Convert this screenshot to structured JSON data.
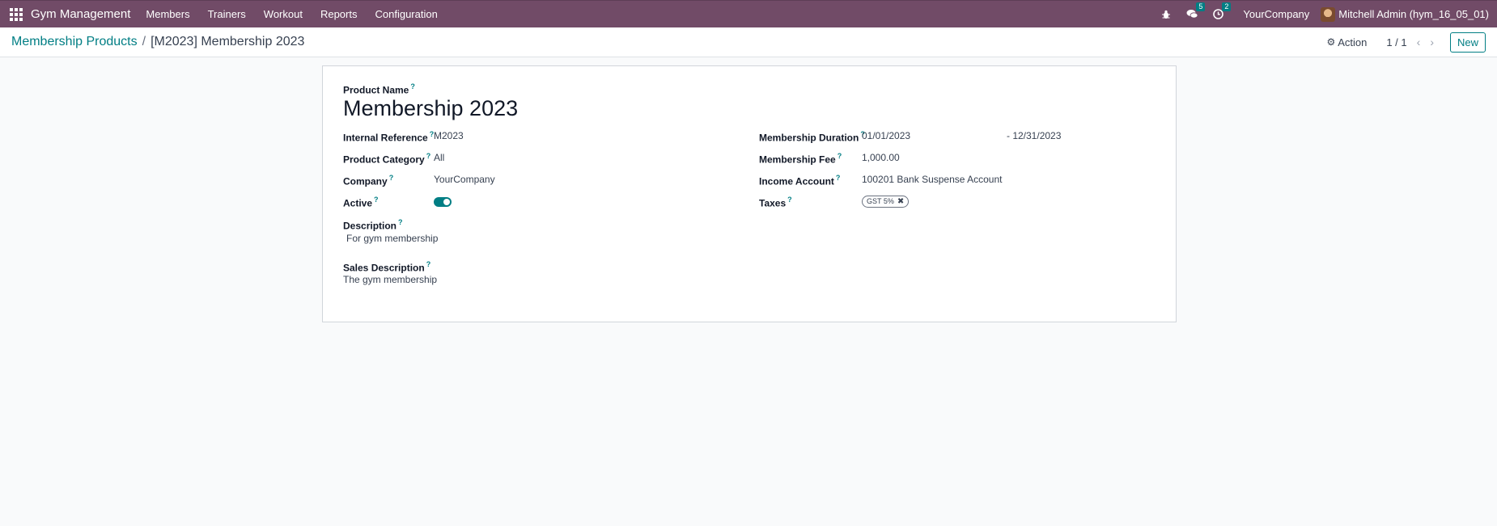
{
  "navbar": {
    "brand": "Gym Management",
    "menu": [
      "Members",
      "Trainers",
      "Workout",
      "Reports",
      "Configuration"
    ],
    "messages_count": "5",
    "activities_count": "2",
    "company": "YourCompany",
    "user": "Mitchell Admin (hym_16_05_01)"
  },
  "control": {
    "breadcrumb_parent": "Membership Products",
    "breadcrumb_sep": "/",
    "breadcrumb_current": "[M2023] Membership 2023",
    "action_label": "Action",
    "pager": "1 / 1",
    "new_label": "New"
  },
  "form": {
    "product_name_label": "Product Name",
    "product_name": "Membership 2023",
    "internal_ref_label": "Internal Reference",
    "internal_ref": "M2023",
    "category_label": "Product Category",
    "category": "All",
    "company_label": "Company",
    "company": "YourCompany",
    "active_label": "Active",
    "description_label": "Description",
    "description": "For gym membership",
    "sales_desc_label": "Sales Description",
    "sales_desc": "The gym membership",
    "duration_label": "Membership Duration",
    "duration_start": "01/01/2023",
    "duration_end": "- 12/31/2023",
    "fee_label": "Membership Fee",
    "fee": "1,000.00",
    "income_label": "Income Account",
    "income": "100201 Bank Suspense Account",
    "taxes_label": "Taxes",
    "tax_tag": "GST 5%",
    "help_mark": "?"
  }
}
